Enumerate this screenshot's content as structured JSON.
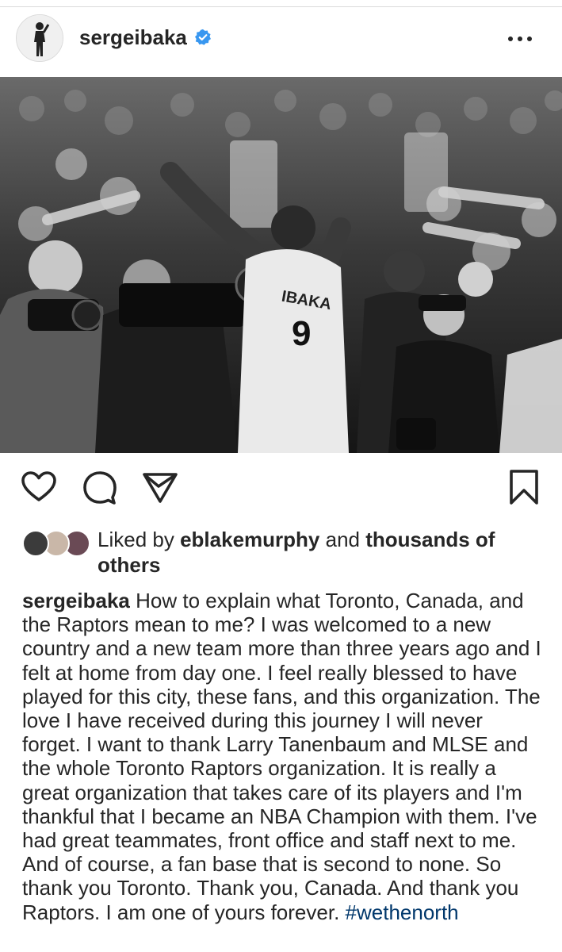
{
  "post": {
    "username": "sergeibaka",
    "verified": true
  },
  "icons": {
    "verified": "verified-badge-icon",
    "more": "more-options-icon",
    "like": "heart-icon",
    "comment": "comment-icon",
    "share": "send-icon",
    "save": "bookmark-icon"
  },
  "photo": {
    "jersey_name": "IBAKA",
    "jersey_number": "9"
  },
  "likes": {
    "prefix": "Liked by",
    "user": "eblakemurphy",
    "middle": "and",
    "rest": "thousands of others"
  },
  "caption": {
    "username": "sergeibaka",
    "text": "How to explain what Toronto, Canada, and the Raptors mean to me? I was welcomed to a new country and a new team more than three years ago and I felt at home from day one. I feel really blessed to have played for this city, these fans, and this organization. The love I have received during this journey I will never forget. I want to thank Larry Tanenbaum and MLSE and the whole Toronto Raptors organization. It is really a great organization that takes care of its players and I'm thankful that I became an NBA Champion with them. I've had great teammates, front office and staff next to me. And of course, a fan base that is second to none. So thank you Toronto. Thank you, Canada. And thank you Raptors. I am one of yours forever.",
    "hashtag": "#wethenorth"
  },
  "colors": {
    "verified_blue": "#3897f0",
    "hashtag_blue": "#00376b",
    "text": "#262626"
  }
}
